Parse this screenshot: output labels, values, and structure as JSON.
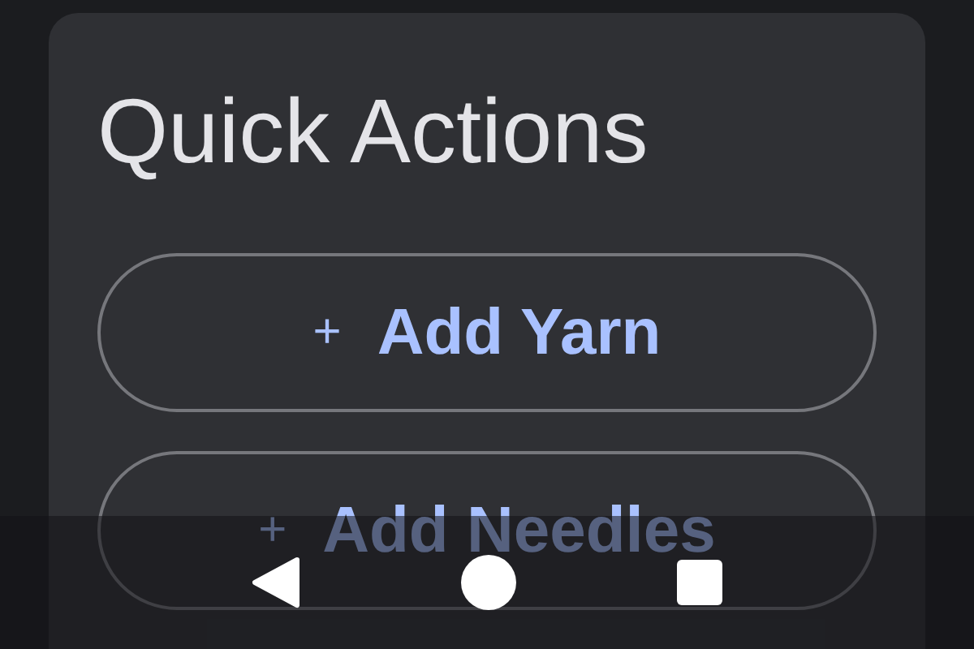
{
  "card": {
    "title": "Quick Actions",
    "actions": [
      {
        "icon": "+",
        "label": "Add Yarn"
      },
      {
        "icon": "+",
        "label": "Add Needles"
      }
    ]
  }
}
